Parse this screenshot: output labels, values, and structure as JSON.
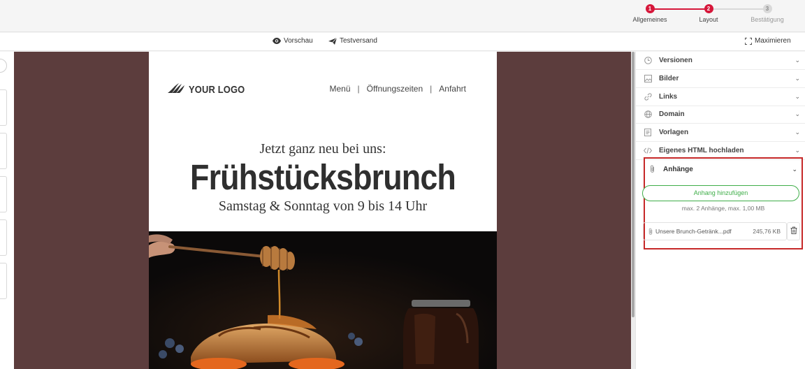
{
  "stepper": {
    "steps": [
      {
        "number": "1",
        "label": "Allgemeines",
        "state": "done"
      },
      {
        "number": "2",
        "label": "Layout",
        "state": "active"
      },
      {
        "number": "3",
        "label": "Bestätigung",
        "state": "pending"
      }
    ],
    "accent_color": "#d6173a"
  },
  "toolbar": {
    "preview_label": "Vorschau",
    "preview_icon": "eye-icon",
    "testsend_label": "Testversand",
    "testsend_icon": "paper-plane-icon",
    "maximize_label": "Maximieren",
    "maximize_icon": "expand-icon"
  },
  "email": {
    "logo_text": "YOUR LOGO",
    "nav": [
      "Menü",
      "Öffnungszeiten",
      "Anfahrt"
    ],
    "nav_separator": "|",
    "headline_intro": "Jetzt ganz neu bei uns:",
    "headline": "Frühstücksbrunch",
    "headline_sub": "Samstag & Sonntag von 9 bis 14 Uhr",
    "canvas_color": "#5c3d3d"
  },
  "panel": {
    "items": [
      {
        "label": "Versionen",
        "icon": "clock-icon"
      },
      {
        "label": "Bilder",
        "icon": "image-icon"
      },
      {
        "label": "Links",
        "icon": "link-icon"
      },
      {
        "label": "Domain",
        "icon": "globe-icon"
      },
      {
        "label": "Vorlagen",
        "icon": "template-icon"
      },
      {
        "label": "Eigenes HTML hochladen",
        "icon": "code-icon"
      }
    ],
    "attachments": {
      "label": "Anhänge",
      "icon": "paperclip-icon",
      "add_button": "Anhang hinzufügen",
      "limit_text": "max. 2 Anhänge, max. 1,00 MB",
      "files": [
        {
          "name": "Unsere Brunch-Getränk...pdf",
          "size": "245,76 KB"
        }
      ],
      "highlight_color": "#c62828",
      "button_color": "#3fae49"
    }
  }
}
